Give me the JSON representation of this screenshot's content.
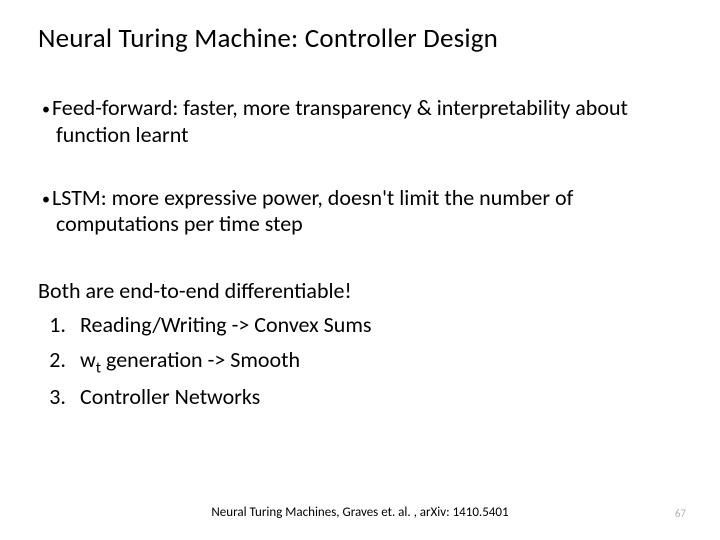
{
  "title": "Neural Turing Machine: Controller Design",
  "bullets": [
    "Feed-forward: faster, more transparency & interpretability about function learnt",
    "LSTM: more expressive power, doesn't limit the number of computations per time step"
  ],
  "differentiable": {
    "heading": "Both are end-to-end differentiable!",
    "items": [
      "Reading/Writing -> Convex Sums",
      "w",
      " generation -> Smooth",
      "Controller Networks"
    ],
    "w_sub": "t"
  },
  "citation": "Neural Turing Machines, Graves et. al. , arXiv: 1410.5401",
  "page": "67"
}
